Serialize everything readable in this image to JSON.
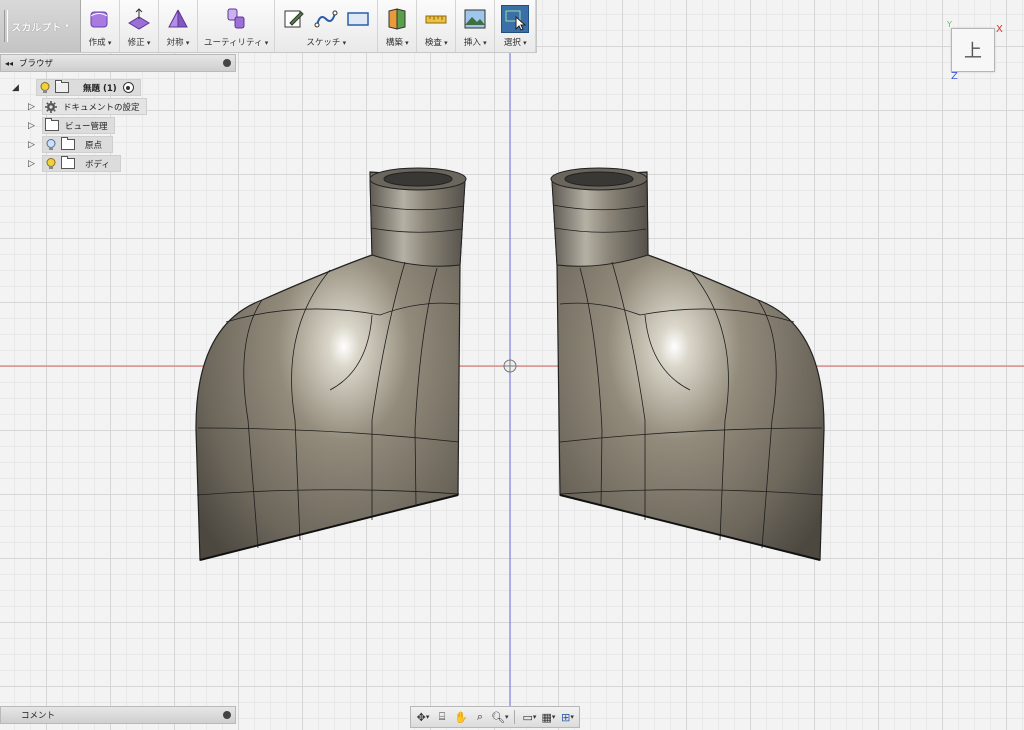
{
  "workspace": {
    "label": "スカルプト"
  },
  "toolbar": {
    "groups": [
      {
        "label": "作成"
      },
      {
        "label": "修正"
      },
      {
        "label": "対称"
      },
      {
        "label": "ユーティリティ"
      },
      {
        "label": "スケッチ"
      },
      {
        "label": "構築"
      },
      {
        "label": "検査"
      },
      {
        "label": "挿入"
      },
      {
        "label": "選択"
      }
    ]
  },
  "browser": {
    "title": "ブラウザ",
    "root": {
      "label": "無題 (1)"
    },
    "items": [
      {
        "label": "ドキュメントの設定",
        "icon": "gear-icon"
      },
      {
        "label": "ビュー管理",
        "icon": "folder-icon"
      },
      {
        "label": "原点",
        "icon": "folder-icon"
      },
      {
        "label": "ボディ",
        "icon": "folder-icon"
      }
    ]
  },
  "comments": {
    "title": "コメント"
  },
  "viewcube": {
    "face": "上",
    "axis_x": "X",
    "axis_y": "Y",
    "axis_z": "Z"
  },
  "colors": {
    "x_axis": "#e03030",
    "z_axis": "#3a5bd8",
    "body": "#7a7468",
    "active_tool": "#3a6fa8"
  }
}
